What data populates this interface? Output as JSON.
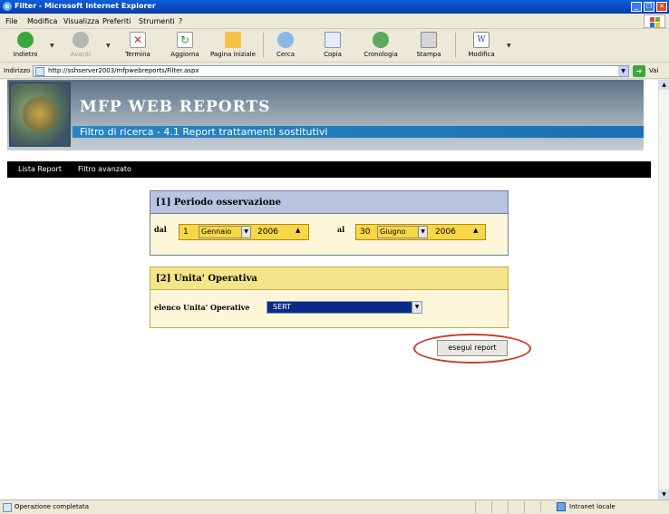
{
  "window": {
    "title": "Filter - Microsoft Internet Explorer",
    "buttons": [
      "_",
      "❐",
      "✕"
    ]
  },
  "menu": [
    "File",
    "Modifica",
    "Visualizza",
    "Preferiti",
    "Strumenti",
    "?"
  ],
  "toolbar": {
    "back": "Indietro",
    "forward": "Avanti",
    "stop": "Termina",
    "refresh": "Aggiorna",
    "home": "Pagina iniziale",
    "search": "Cerca",
    "copy": "Copia",
    "history": "Cronologia",
    "print": "Stampa",
    "edit": "Modifica"
  },
  "address": {
    "label": "Indirizzo",
    "url": "http://sshserver2003/mfpwebreports/Filter.aspx",
    "go": "Vai"
  },
  "banner": {
    "app_title": "MFP WEB REPORTS",
    "subtitle": "Filtro di ricerca - 4.1 Report trattamenti sostitutivi"
  },
  "nav": {
    "items": [
      "Lista Report",
      "Filtro avanzato"
    ]
  },
  "period": {
    "title": "[1] Periodo osservazione",
    "from_label": "dal",
    "to_label": "al",
    "from": {
      "day": "1",
      "month": "Gennaio",
      "year": "2006"
    },
    "to": {
      "day": "30",
      "month": "Giugno",
      "year": "2006"
    }
  },
  "unit": {
    "title": "[2] Unita' Operativa",
    "list_label": "elenco Unita' Operative",
    "selected": "SERT"
  },
  "actions": {
    "run": "esegui report"
  },
  "status": {
    "text": "Operazione completata",
    "zone": "Intranet locale"
  },
  "colors": {
    "period_header": "#b8c4e0",
    "unit_header": "#f3e58a",
    "field_yellow": "#f7d743",
    "highlight_ring": "#cf3a27"
  }
}
